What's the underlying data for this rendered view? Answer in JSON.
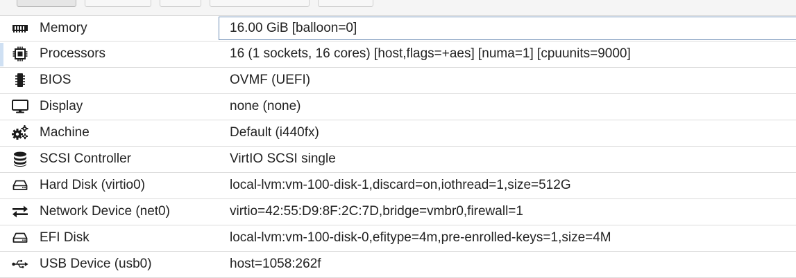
{
  "hardware": {
    "rows": [
      {
        "icon": "memory-icon",
        "name": "Memory",
        "value": "16.00 GiB [balloon=0]"
      },
      {
        "icon": "processor-icon",
        "name": "Processors",
        "value": "16 (1 sockets, 16 cores) [host,flags=+aes] [numa=1] [cpuunits=9000]"
      },
      {
        "icon": "chip-icon",
        "name": "BIOS",
        "value": "OVMF (UEFI)"
      },
      {
        "icon": "monitor-icon",
        "name": "Display",
        "value": "none (none)"
      },
      {
        "icon": "cogs-icon",
        "name": "Machine",
        "value": "Default (i440fx)"
      },
      {
        "icon": "database-icon",
        "name": "SCSI Controller",
        "value": "VirtIO SCSI single"
      },
      {
        "icon": "hdd-icon",
        "name": "Hard Disk (virtio0)",
        "value": "local-lvm:vm-100-disk-1,discard=on,iothread=1,size=512G"
      },
      {
        "icon": "exchange-icon",
        "name": "Network Device (net0)",
        "value": "virtio=42:55:D9:8F:2C:7D,bridge=vmbr0,firewall=1"
      },
      {
        "icon": "hdd-icon",
        "name": "EFI Disk",
        "value": "local-lvm:vm-100-disk-0,efitype=4m,pre-enrolled-keys=1,size=4M"
      },
      {
        "icon": "usb-icon",
        "name": "USB Device (usb0)",
        "value": "host=1058:262f"
      }
    ]
  }
}
